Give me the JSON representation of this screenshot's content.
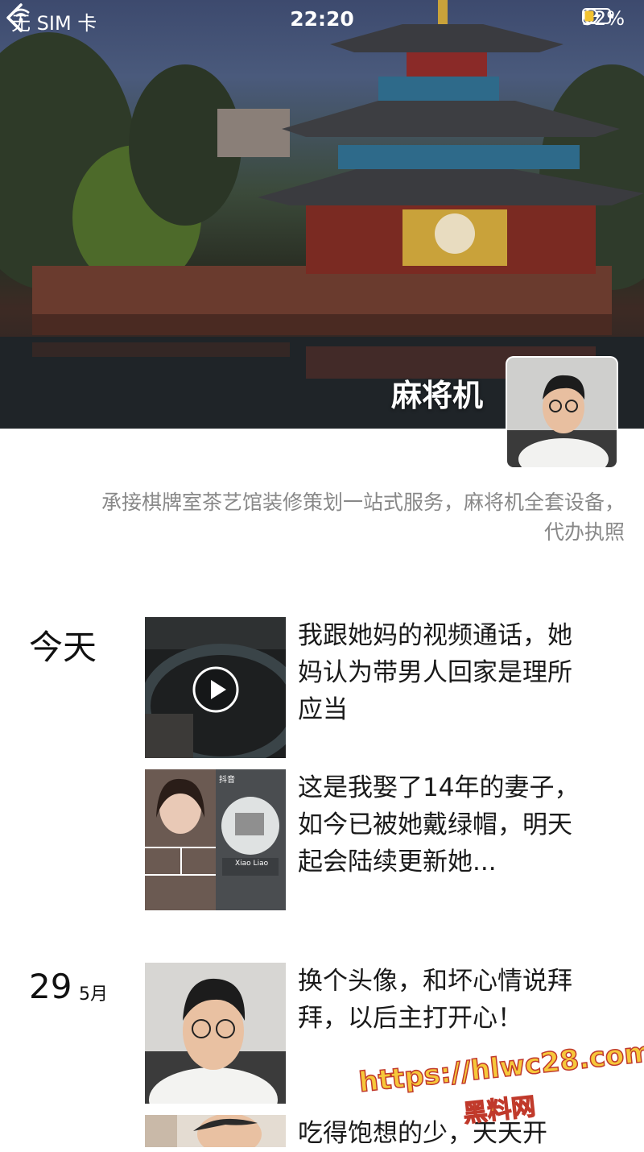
{
  "status_bar": {
    "carrier": "无 SIM 卡",
    "time": "22:20",
    "battery": "32%"
  },
  "profile": {
    "name": "麻将机",
    "signature": "承接棋牌室茶艺馆装修策划一站式服务，麻将机全套设备，代办执照"
  },
  "feed": {
    "groups": [
      {
        "date_label": "今天",
        "posts": [
          {
            "type": "video",
            "text": "我跟她妈的视频通话，她妈认为带男人回家是理所应当"
          },
          {
            "type": "image",
            "text": "这是我娶了14年的妻子，如今已被她戴绿帽，明天起会陆续更新她...",
            "thumb_label": "抖音",
            "thumb_caption": "Xiao Liao"
          }
        ]
      },
      {
        "date_day": "29",
        "date_month": "5月",
        "posts": [
          {
            "type": "image",
            "text": "换个头像，和坏心情说拜拜，以后主打开心！"
          },
          {
            "type": "image",
            "text": "吃得饱想的少，天天开"
          }
        ]
      }
    ]
  },
  "watermark": {
    "url": "https://hlwc28.com",
    "name": "黑料网"
  },
  "colors": {
    "signature_gray": "#888888",
    "watermark_fill": "#f6c83a",
    "watermark_stroke": "#c0392b"
  },
  "icons": [
    "wifi-icon",
    "back-chevron-icon",
    "rotation-lock-icon",
    "battery-charging-icon",
    "play-icon"
  ]
}
